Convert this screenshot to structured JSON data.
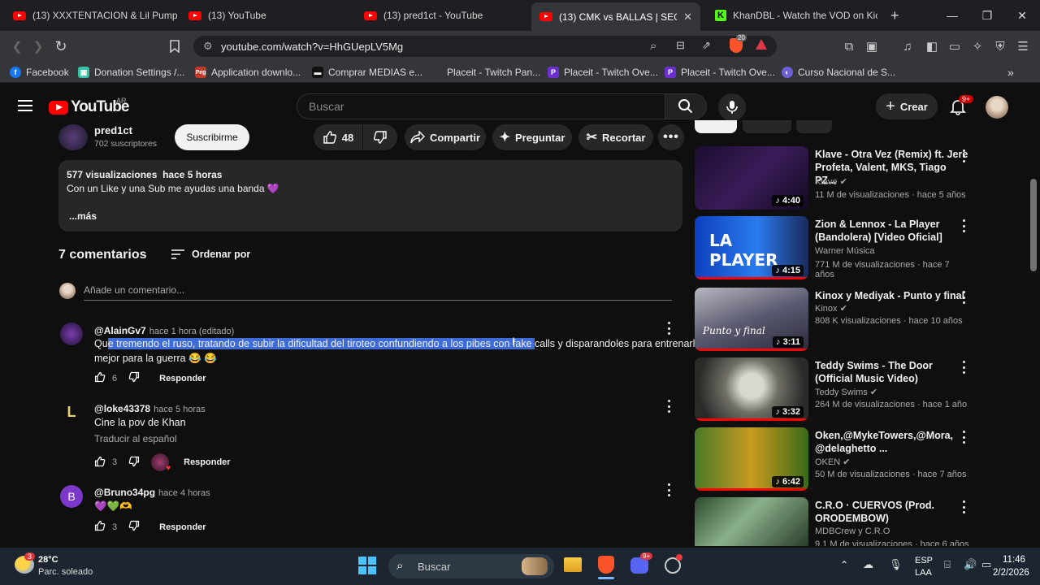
{
  "browser": {
    "tabs": [
      {
        "title": "(13) XXXTENTACION & Lil Pump -"
      },
      {
        "title": "(13) YouTube"
      },
      {
        "title": "(13) pred1ct - YouTube"
      },
      {
        "title": "(13) CMK vs BALLAS | SEGUN"
      },
      {
        "title": "KhanDBL - Watch the VOD on Kic"
      }
    ],
    "new_tab": "+",
    "url": "youtube.com/watch?v=HhGUepLV5Mg",
    "shield_badge": "20",
    "bookmarks": [
      {
        "label": "Facebook",
        "color": "#1877f2",
        "glyph": "f"
      },
      {
        "label": "Donation Settings /...",
        "color": "#38c0a5",
        "glyph": "▣"
      },
      {
        "label": "Application downlo...",
        "color": "#c0392b",
        "glyph": "Peg"
      },
      {
        "label": "Comprar MEDIAS e...",
        "color": "#111111",
        "glyph": "▬"
      },
      {
        "label": "Placeit - Twitch Pan...",
        "color": "#35363a",
        "glyph": ""
      },
      {
        "label": "Placeit - Twitch Ove...",
        "color": "#6b2fd0",
        "glyph": "P"
      },
      {
        "label": "Placeit - Twitch Ove...",
        "color": "#6b2fd0",
        "glyph": "P"
      },
      {
        "label": "Curso Nacional de S...",
        "color": "#6d5fd6",
        "glyph": "◐"
      }
    ]
  },
  "yt": {
    "logo": "YouTube",
    "country": "AR",
    "search_placeholder": "Buscar",
    "create_label": "Crear",
    "notif_badge": "9+"
  },
  "channel": {
    "name": "pred1ct",
    "subs": "702 suscriptores",
    "subscribe": "Suscribirme",
    "likes": "48",
    "share": "Compartir",
    "ask": "Preguntar",
    "clip": "Recortar"
  },
  "description": {
    "meta": "577 visualizaciones  hace 5 horas",
    "text": "Con un Like y una Sub me ayudas una banda 💜",
    "more": "...más"
  },
  "comments_header": {
    "count": "7 comentarios",
    "sort": "Ordenar por",
    "add_placeholder": "Añade un comentario..."
  },
  "comments": [
    {
      "author": "@AlainGv7",
      "time": "hace 1 hora (editado)",
      "text_pre": "Qu",
      "text_sel": "e tremendo el ruso, tratando de subir la dificultad del tiroteo confundiendo a los pibes con fake ",
      "text_post": "calls y disparandoles para entrenarlos",
      "text_line2": "mejor para la guerra 😂 😂",
      "likes": "6",
      "reply": "Responder"
    },
    {
      "author": "@loke43378",
      "time": "hace 5 horas",
      "text": "Cine la pov de Khan",
      "translate": "Traducir al español",
      "likes": "3",
      "reply": "Responder"
    },
    {
      "author": "@Bruno34pg",
      "time": "hace 4 horas",
      "text": "💜💚🫶",
      "avatar_letter": "B",
      "likes": "3",
      "reply": "Responder"
    }
  ],
  "related": [
    {
      "title": "Klave - Otra Vez (Remix) ft. Jere Profeta, Valent, MKS, Tiago PZ...",
      "channel": "Klave",
      "meta": "11 M de visualizaciones · hace 5 años",
      "duration": "4:40"
    },
    {
      "title": "Zion & Lennox - La Player (Bandolera) [Video Oficial]",
      "channel": "Warner Música",
      "meta": "771 M de visualizaciones · hace 7 años",
      "duration": "4:15"
    },
    {
      "title": "Kinox y Mediyak - Punto y final",
      "channel": "Kinox",
      "meta": "808 K visualizaciones · hace 10 años",
      "duration": "3:11"
    },
    {
      "title": "Teddy Swims - The Door (Official Music Video)",
      "channel": "Teddy Swims",
      "meta": "264 M de visualizaciones · hace 1 año",
      "duration": "3:32"
    },
    {
      "title": "Oken,@MykeTowers,@Mora, @delaghetto ...",
      "channel": "OKEN",
      "meta": "50 M de visualizaciones · hace 7 años",
      "duration": "6:42"
    },
    {
      "title": "C.R.O · CUERVOS (Prod. ORODEMBOW)",
      "channel": "MDBCrew  y C.R.O",
      "meta": "9,1 M de visualizaciones · hace 6 años",
      "duration": ""
    }
  ],
  "taskbar": {
    "temp": "28°C",
    "weather": "Parc. soleado",
    "weather_badge": "3",
    "search": "Buscar",
    "lang1": "ESP",
    "lang2": "LAA",
    "time": "11:46",
    "date": "2/2/2026",
    "discord_badge": "9+"
  },
  "colors": {
    "accent": "#ff0000",
    "selection": "#3d6bd8"
  }
}
